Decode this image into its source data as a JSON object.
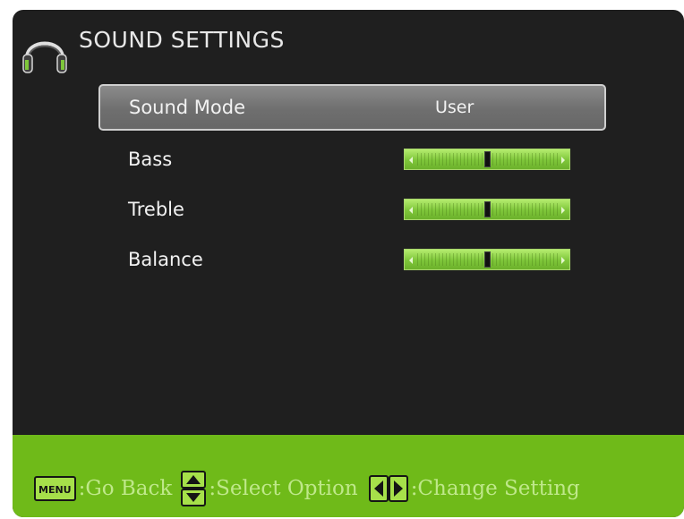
{
  "colors": {
    "accent": "#6fba19",
    "background": "#1f1f1f",
    "slider_fill": "#7ec63a",
    "selected_row": "#7a7a7a"
  },
  "header": {
    "title": "SOUND SETTINGS",
    "icon": "headphones-icon"
  },
  "menu": {
    "items": [
      {
        "label": "Sound Mode",
        "type": "value",
        "value": "User",
        "selected": true
      },
      {
        "label": "Bass",
        "type": "slider",
        "level": 0.5
      },
      {
        "label": "Treble",
        "type": "slider",
        "level": 0.5
      },
      {
        "label": "Balance",
        "type": "slider",
        "level": 0.5
      }
    ]
  },
  "footer": {
    "menu_key": "MENU",
    "go_back": ":Go Back",
    "select_option": ":Select Option",
    "change_setting": ":Change Setting",
    "icons": [
      "menu-key-icon",
      "up-down-arrows-icon",
      "left-right-arrows-icon"
    ]
  }
}
